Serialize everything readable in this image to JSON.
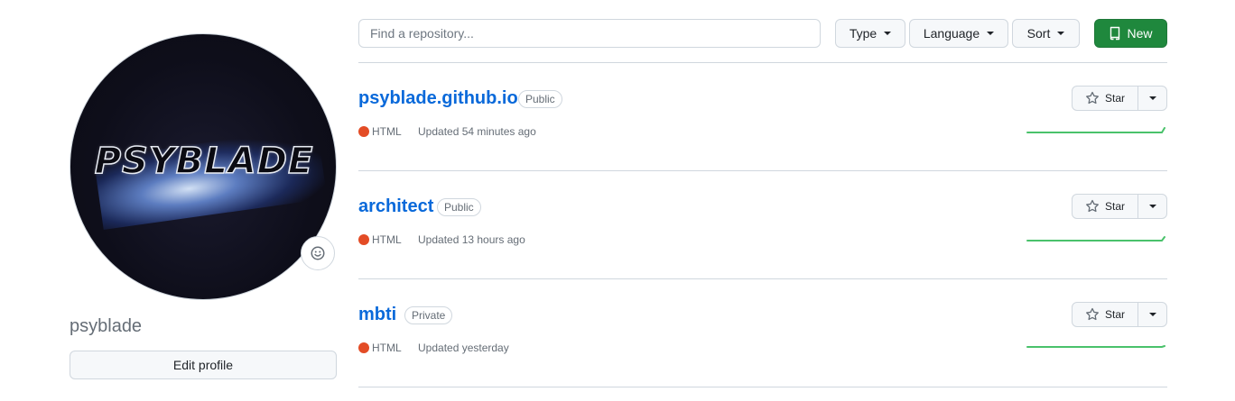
{
  "profile": {
    "avatar_text": "PSYBLADE",
    "username": "psyblade",
    "edit_label": "Edit profile",
    "status_icon": "smiley-icon"
  },
  "filters": {
    "search_placeholder": "Find a repository...",
    "type_label": "Type",
    "language_label": "Language",
    "sort_label": "Sort",
    "new_label": "New"
  },
  "colors": {
    "link": "#0969da",
    "new_button": "#1f883d",
    "html_language": "#e34c26",
    "sparkline": "#4ac26b"
  },
  "repos": [
    {
      "name": "psyblade.github.io",
      "visibility": "Public",
      "language": "HTML",
      "updated": "Updated 54 minutes ago",
      "star_label": "Star"
    },
    {
      "name": "architect",
      "visibility": "Public",
      "language": "HTML",
      "updated": "Updated 13 hours ago",
      "star_label": "Star"
    },
    {
      "name": "mbti",
      "visibility": "Private",
      "language": "HTML",
      "updated": "Updated yesterday",
      "star_label": "Star"
    }
  ]
}
